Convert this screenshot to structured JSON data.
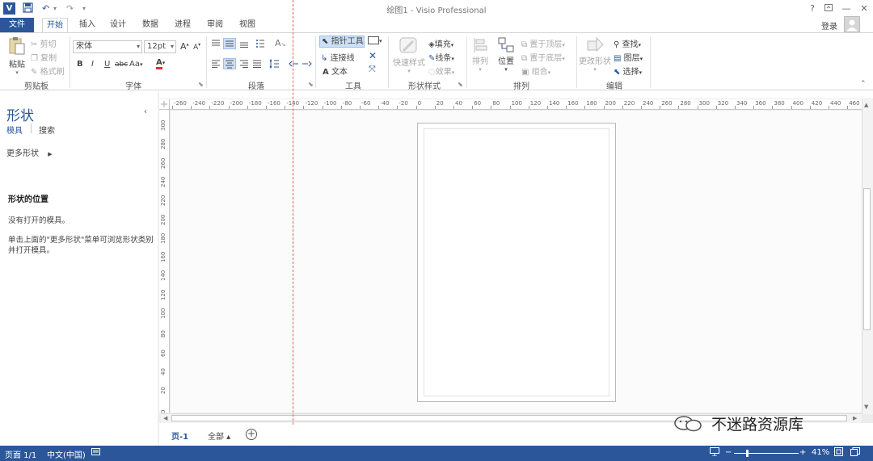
{
  "window": {
    "title": "绘图1 - Visio Professional",
    "help": "?",
    "minimize": "—",
    "maximize": "□",
    "close": "✕"
  },
  "qat": {
    "app_letter": "V",
    "undo": "↶",
    "redo": "↷",
    "customize": "▾"
  },
  "tabs": [
    "文件",
    "开始",
    "插入",
    "设计",
    "数据",
    "进程",
    "审阅",
    "视图"
  ],
  "account": {
    "login": "登录"
  },
  "ribbon": {
    "clipboard": {
      "paste": "粘贴",
      "cut": "剪切",
      "copy": "复制",
      "format_painter": "格式刷",
      "label": "剪贴板"
    },
    "font": {
      "font_name": "宋体",
      "font_size": "12pt",
      "grow": "A",
      "shrink": "A",
      "bold": "B",
      "italic": "I",
      "underline": "U",
      "strike": "abc",
      "case": "Aa",
      "color": "A",
      "label": "字体"
    },
    "paragraph": {
      "label": "段落"
    },
    "tools": {
      "pointer": "指针工具",
      "connector": "连接线",
      "text": "文本",
      "label": "工具"
    },
    "shape_styles": {
      "quick_styles": "快速样式",
      "fill": "填充",
      "line": "线条",
      "effects": "效果",
      "label": "形状样式"
    },
    "arrange": {
      "arrange": "排列",
      "position": "位置",
      "bring_front": "置于顶层",
      "send_back": "置于底层",
      "group": "组合",
      "label": "排列"
    },
    "editing": {
      "change_shape": "更改形状",
      "find": "查找",
      "layers": "图层",
      "select": "选择",
      "label": "编辑"
    }
  },
  "shapes_pane": {
    "title": "形状",
    "collapse": "‹",
    "tab_stencils": "模具",
    "tab_search": "搜索",
    "more_shapes": "更多形状",
    "more_arrow": "▶",
    "location_title": "形状的位置",
    "no_stencils": "没有打开的模具。",
    "hint": "单击上面的\"更多形状\"菜单可浏览形状类别并打开模具。"
  },
  "ruler": {
    "h_ticks": [
      "-260",
      "-240",
      "-220",
      "-200",
      "-180",
      "-160",
      "-140",
      "-120",
      "-100",
      "-80",
      "-60",
      "-40",
      "-20",
      "0",
      "20",
      "40",
      "60",
      "80",
      "100",
      "120",
      "140",
      "160",
      "180",
      "200",
      "220",
      "240",
      "260",
      "280",
      "300",
      "320",
      "340",
      "360",
      "380",
      "400",
      "420",
      "440",
      "460"
    ],
    "v_ticks": [
      "300",
      "280",
      "260",
      "240",
      "220",
      "200",
      "180",
      "160",
      "140",
      "120",
      "100",
      "80",
      "60",
      "40",
      "20",
      "0"
    ]
  },
  "page_tabs": {
    "page1": "页-1",
    "all": "全部 ▴",
    "add": "+"
  },
  "watermark": "不迷路资源库",
  "status": {
    "page": "页面 1/1",
    "language": "中文(中国)",
    "zoom": "41%",
    "zoom_minus": "−",
    "zoom_plus": "+",
    "zoom_level": 0.41
  },
  "colors": {
    "accent": "#2b579a",
    "guide": "#e05a5a"
  }
}
